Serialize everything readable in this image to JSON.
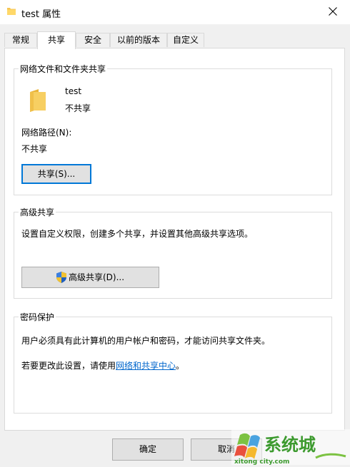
{
  "window": {
    "title": "test 属性",
    "close_icon": "close-icon",
    "folder_icon": "folder-icon"
  },
  "tabs": [
    {
      "label": "常规",
      "active": false
    },
    {
      "label": "共享",
      "active": true
    },
    {
      "label": "安全",
      "active": false
    },
    {
      "label": "以前的版本",
      "active": false
    },
    {
      "label": "自定义",
      "active": false
    }
  ],
  "network_sharing": {
    "title": "网络文件和文件夹共享",
    "folder_name": "test",
    "folder_status": "不共享",
    "path_label": "网络路径(N):",
    "path_value": "不共享",
    "share_button": "共享(S)..."
  },
  "advanced_sharing": {
    "title": "高级共享",
    "description": "设置自定义权限，创建多个共享，并设置其他高级共享选项。",
    "button": "高级共享(D)...",
    "button_icon": "uac-shield-icon"
  },
  "password_protection": {
    "title": "密码保护",
    "description": "用户必须具有此计算机的用户帐户和密码，才能访问共享文件夹。",
    "change_prefix": "若要更改此设置，请使用",
    "change_link": "网络和共享中心",
    "change_suffix": "。"
  },
  "footer": {
    "ok_button": "确定",
    "cancel_button": "取消"
  },
  "watermark": {
    "brand": "系统城",
    "domain": "xitong city.com"
  },
  "colors": {
    "link": "#0066cc",
    "focus": "#0078d7",
    "folder": "#f5c451"
  }
}
